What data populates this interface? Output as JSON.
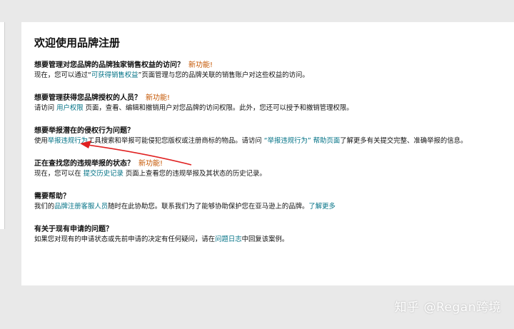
{
  "page": {
    "title": "欢迎使用品牌注册"
  },
  "sections": [
    {
      "question": "想要管理对您品牌的品牌独家销售权益的访问？",
      "badge": "新功能!",
      "desc_1": "现在，您可以通过“",
      "link_1": "可获得销售权益",
      "desc_2": "”页面管理与您的品牌关联的销售账户对这些权益的访问。"
    },
    {
      "question": "想要管理获得您品牌授权的人员？",
      "badge": "新功能!",
      "desc_1": "请访问 ",
      "link_1": "用户权限",
      "desc_2": " 页面，查看、编辑和撤销用户对您品牌的访问权限。此外，您还可以授予和撤销管理权限。"
    },
    {
      "question": "想要举报潜在的侵权行为问题？",
      "desc_1": "使用",
      "link_1": "举报违规行为",
      "desc_2": "工具搜索和举报可能侵犯您版权或注册商标的物品。请访问 ",
      "link_2": "“举报违规行为” 帮助页面",
      "desc_3": "了解更多有关提交完整、准确举报的信息。"
    },
    {
      "question": "正在查找您的违规举报的状态？",
      "badge": "新功能!",
      "desc_1": "现在，您可以在 ",
      "link_1": "提交历史记录",
      "desc_2": " 页面上查看您的违规举报及其状态的历史记录。"
    },
    {
      "question": "需要帮助？",
      "desc_1": "我们的",
      "link_1": "品牌注册客服人员",
      "desc_2": "随时在此协助您。联系我们为了能够协助保护您在亚马逊上的品牌。",
      "link_2": "了解更多"
    },
    {
      "question": "有关于现有申请的问题？",
      "desc_1": "如果您对现有的申请状态或先前申请的决定有任何疑问，请在",
      "link_1": "问题日志",
      "desc_2": "中回复该案例。"
    }
  ],
  "watermark": "知乎 @Regan跨境",
  "colors": {
    "link": "#007185",
    "badge": "#c45500",
    "arrow": "#e02020"
  }
}
